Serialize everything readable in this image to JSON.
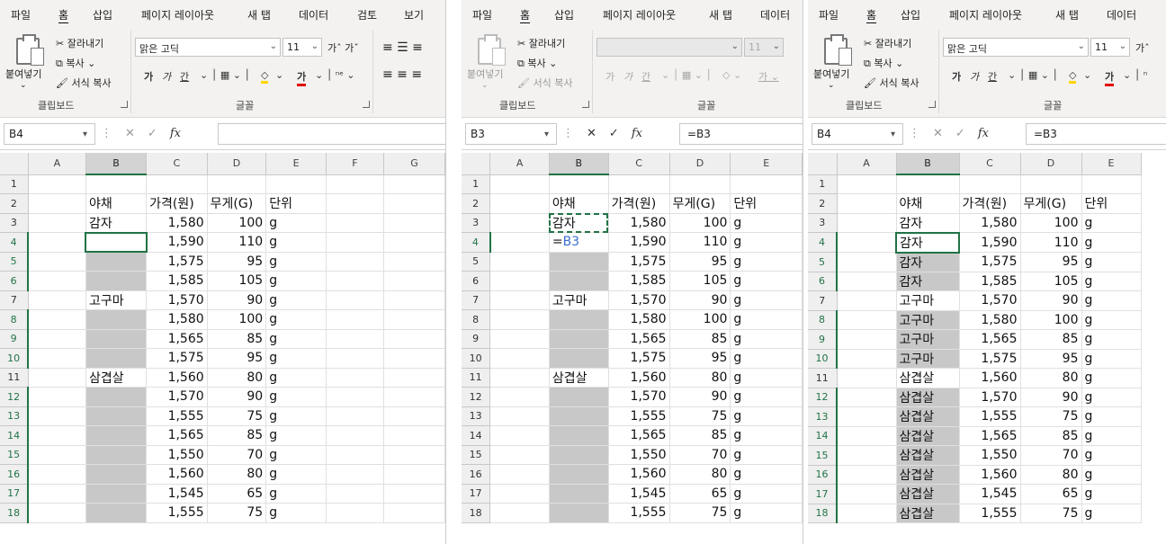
{
  "ribbon": {
    "tabs": [
      "파일",
      "홈",
      "삽입",
      "페이지 레이아웃",
      "새 탭",
      "데이터",
      "검토",
      "보기"
    ],
    "clipboard": {
      "paste": "붙여넣기",
      "cut": "잘라내기",
      "copy": "복사",
      "format_painter": "서식 복사",
      "group_label": "클립보드"
    },
    "font": {
      "name": "맑은 고딕",
      "size": "11",
      "bold": "가",
      "italic": "가",
      "underline": "간",
      "group_label": "글꼴"
    }
  },
  "columns_full": [
    "A",
    "B",
    "C",
    "D",
    "E",
    "F",
    "G"
  ],
  "columns_short": [
    "A",
    "B",
    "C",
    "D",
    "E"
  ],
  "rows": [
    {
      "n": "1",
      "veg": "",
      "price": "",
      "weight": "",
      "unit": ""
    },
    {
      "n": "2",
      "veg": "야채",
      "price": "가격(원)",
      "weight": "무게(G)",
      "unit": "단위"
    },
    {
      "n": "3",
      "veg": "감자",
      "price": "1,580",
      "weight": "100",
      "unit": "g"
    },
    {
      "n": "4",
      "veg": "",
      "price": "1,590",
      "weight": "110",
      "unit": "g"
    },
    {
      "n": "5",
      "veg": "",
      "price": "1,575",
      "weight": "95",
      "unit": "g"
    },
    {
      "n": "6",
      "veg": "",
      "price": "1,585",
      "weight": "105",
      "unit": "g"
    },
    {
      "n": "7",
      "veg": "고구마",
      "price": "1,570",
      "weight": "90",
      "unit": "g"
    },
    {
      "n": "8",
      "veg": "",
      "price": "1,580",
      "weight": "100",
      "unit": "g"
    },
    {
      "n": "9",
      "veg": "",
      "price": "1,565",
      "weight": "85",
      "unit": "g"
    },
    {
      "n": "10",
      "veg": "",
      "price": "1,575",
      "weight": "95",
      "unit": "g"
    },
    {
      "n": "11",
      "veg": "삼겹살",
      "price": "1,560",
      "weight": "80",
      "unit": "g"
    },
    {
      "n": "12",
      "veg": "",
      "price": "1,570",
      "weight": "90",
      "unit": "g"
    },
    {
      "n": "13",
      "veg": "",
      "price": "1,555",
      "weight": "75",
      "unit": "g"
    },
    {
      "n": "14",
      "veg": "",
      "price": "1,565",
      "weight": "85",
      "unit": "g"
    },
    {
      "n": "15",
      "veg": "",
      "price": "1,550",
      "weight": "70",
      "unit": "g"
    },
    {
      "n": "16",
      "veg": "",
      "price": "1,560",
      "weight": "80",
      "unit": "g"
    },
    {
      "n": "17",
      "veg": "",
      "price": "1,545",
      "weight": "65",
      "unit": "g"
    },
    {
      "n": "18",
      "veg": "",
      "price": "1,555",
      "weight": "75",
      "unit": "g"
    }
  ],
  "filled_veg": [
    "",
    "야채",
    "감자",
    "감자",
    "감자",
    "감자",
    "고구마",
    "고구마",
    "고구마",
    "고구마",
    "삼겹살",
    "삼겹살",
    "삼겹살",
    "삼겹살",
    "삼겹살",
    "삼겹살",
    "삼겹살",
    "삼겹살"
  ],
  "panels": [
    {
      "namebox": "B4",
      "formula": "",
      "fx": "fx"
    },
    {
      "namebox": "B3",
      "formula": "=B3",
      "fx": "fx",
      "editing_prefix": "=",
      "editing_ref": "B3"
    },
    {
      "namebox": "B4",
      "formula": "=B3",
      "fx": "fx"
    }
  ],
  "colors": {
    "accent": "#217346",
    "shade": "#c8c8c8",
    "ref": "#3b6fd4"
  }
}
